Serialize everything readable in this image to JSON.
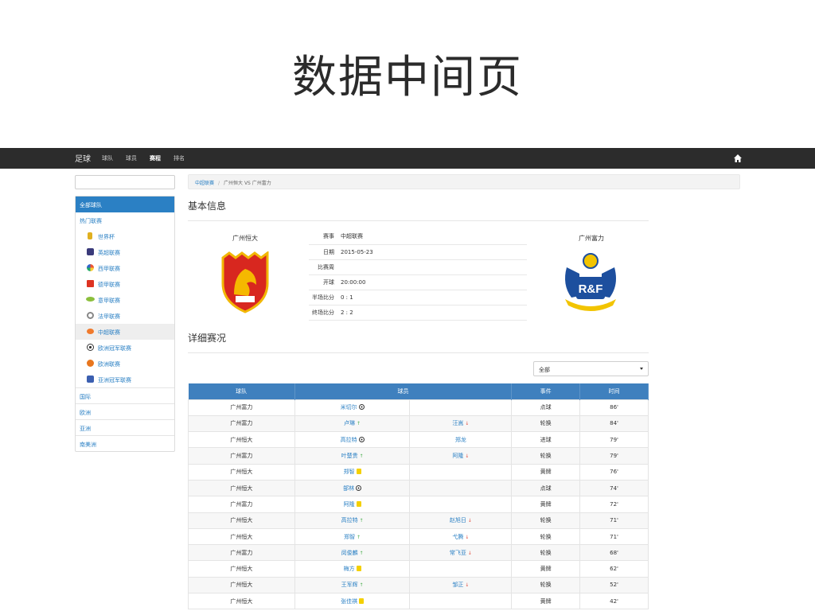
{
  "slide_title": "数据中间页",
  "nav": {
    "brand": "足球",
    "items": [
      "球队",
      "球员",
      "赛程",
      "排名"
    ],
    "active_index": 2
  },
  "sidebar": {
    "header": "全部球队",
    "hot_label": "热门联赛",
    "leagues": [
      "世界杯",
      "英超联赛",
      "西甲联赛",
      "德甲联赛",
      "意甲联赛",
      "法甲联赛",
      "中超联赛",
      "欧洲冠军联赛",
      "欧洲联赛",
      "亚洲冠军联赛"
    ],
    "active_league": "中超联赛",
    "groups": [
      "国际",
      "欧洲",
      "亚洲",
      "南美洲"
    ]
  },
  "breadcrumb": {
    "root": "中超联赛",
    "sep": "/",
    "current": "广州恒大 VS 广州富力"
  },
  "basic_info": {
    "title": "基本信息",
    "home_team": "广州恒大",
    "away_team": "广州富力",
    "away_logo_text": "R&F",
    "rows": [
      {
        "k": "赛事",
        "v": "中超联赛"
      },
      {
        "k": "日期",
        "v": "2015-05-23"
      },
      {
        "k": "比赛周",
        "v": ""
      },
      {
        "k": "开球",
        "v": "20:00:00"
      },
      {
        "k": "半场比分",
        "v": "0 : 1"
      },
      {
        "k": "终场比分",
        "v": "2 : 2"
      }
    ]
  },
  "details": {
    "title": "详细赛况",
    "filter_value": "全部",
    "headers": [
      "球队",
      "球员",
      "事件",
      "时间"
    ],
    "rows": [
      {
        "team": "广州富力",
        "p1": "米切尔",
        "m1": "ball",
        "p2": "",
        "m2": "",
        "event": "点球",
        "time": "86'"
      },
      {
        "team": "广州富力",
        "p1": "卢琳",
        "m1": "up",
        "p2": "汪嵩",
        "m2": "down",
        "event": "轮换",
        "time": "84'"
      },
      {
        "team": "广州恒大",
        "p1": "高拉特",
        "m1": "ball",
        "p2": "郑龙",
        "m2": "",
        "event": "进球",
        "time": "79'"
      },
      {
        "team": "广州富力",
        "p1": "叶楚贵",
        "m1": "up",
        "p2": "阿隆",
        "m2": "down",
        "event": "轮换",
        "time": "79'"
      },
      {
        "team": "广州恒大",
        "p1": "郑智",
        "m1": "card",
        "p2": "",
        "m2": "",
        "event": "黄牌",
        "time": "76'"
      },
      {
        "team": "广州恒大",
        "p1": "郜林",
        "m1": "ball",
        "p2": "",
        "m2": "",
        "event": "点球",
        "time": "74'"
      },
      {
        "team": "广州富力",
        "p1": "阿隆",
        "m1": "card",
        "p2": "",
        "m2": "",
        "event": "黄牌",
        "time": "72'"
      },
      {
        "team": "广州恒大",
        "p1": "高拉特",
        "m1": "up",
        "p2": "赵旭日",
        "m2": "down",
        "event": "轮换",
        "time": "71'"
      },
      {
        "team": "广州恒大",
        "p1": "郑智",
        "m1": "up",
        "p2": "弋腾",
        "m2": "down",
        "event": "轮换",
        "time": "71'"
      },
      {
        "team": "广州富力",
        "p1": "闵俊麟",
        "m1": "up",
        "p2": "常飞亚",
        "m2": "down",
        "event": "轮换",
        "time": "68'"
      },
      {
        "team": "广州恒大",
        "p1": "梅方",
        "m1": "card",
        "p2": "",
        "m2": "",
        "event": "黄牌",
        "time": "62'"
      },
      {
        "team": "广州恒大",
        "p1": "王军辉",
        "m1": "up",
        "p2": "邹正",
        "m2": "down",
        "event": "轮换",
        "time": "52'"
      },
      {
        "team": "广州恒大",
        "p1": "张佳祺",
        "m1": "card",
        "p2": "",
        "m2": "",
        "event": "黄牌",
        "time": "42'"
      }
    ]
  },
  "colors": {
    "accent": "#2b80c4",
    "navbar": "#2c2c2c",
    "table_header": "#3f80be"
  }
}
